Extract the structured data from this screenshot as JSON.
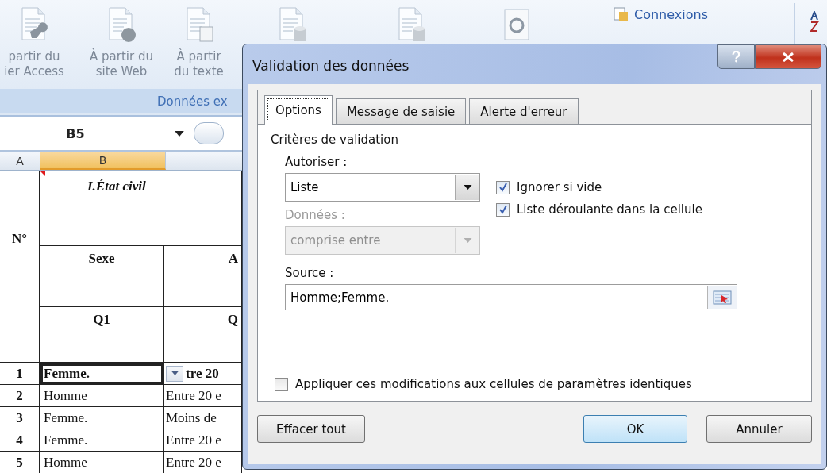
{
  "ribbon": {
    "buttons": [
      {
        "kind": "access",
        "lines": [
          "partir du",
          "ier Access"
        ]
      },
      {
        "kind": "web",
        "lines": [
          "À partir du",
          "site Web"
        ]
      },
      {
        "kind": "text",
        "lines": [
          "À partir",
          "du texte"
        ]
      },
      {
        "kind": "database"
      },
      {
        "kind": "database"
      },
      {
        "kind": "refresh"
      }
    ],
    "group_label": "Données ex",
    "connections": "Connexions"
  },
  "name_box": "B5",
  "column_headers": [
    {
      "label": "A",
      "selected": false
    },
    {
      "label": "B",
      "selected": true
    }
  ],
  "sheet": {
    "title": "I.État civil",
    "number_header": "N°",
    "headers": [
      "Sexe",
      "A"
    ],
    "codes": [
      "Q1",
      "Q"
    ],
    "rows": [
      {
        "n": "1",
        "sexe": "Femme.",
        "age": "tre 20",
        "selected": true
      },
      {
        "n": "2",
        "sexe": "Homme",
        "age": "Entre 20 e",
        "selected": false
      },
      {
        "n": "3",
        "sexe": "Femme.",
        "age": "Moins de",
        "selected": false
      },
      {
        "n": "4",
        "sexe": "Femme.",
        "age": "Entre 20 e",
        "selected": false
      },
      {
        "n": "5",
        "sexe": "Homme",
        "age": "Entre 20 e",
        "selected": false
      }
    ]
  },
  "dialog": {
    "title": "Validation des données",
    "tabs": [
      {
        "label": "Options",
        "selected": true
      },
      {
        "label": "Message de saisie",
        "selected": false
      },
      {
        "label": "Alerte d'erreur",
        "selected": false
      }
    ],
    "section": "Critères de validation",
    "allow": {
      "label": "Autoriser :",
      "value": "Liste",
      "disabled": false
    },
    "data": {
      "label": "Données :",
      "value": "comprise entre",
      "disabled": true
    },
    "checkboxes": [
      {
        "label": "Ignorer si vide",
        "checked": true
      },
      {
        "label": "Liste déroulante dans la cellule",
        "checked": true
      }
    ],
    "source": {
      "label": "Source :",
      "value": "Homme;Femme."
    },
    "apply": {
      "label": "Appliquer ces modifications aux cellules de paramètres identiques",
      "checked": false
    },
    "buttons": [
      {
        "label": "Effacer tout",
        "kind": "clear"
      },
      {
        "label": "OK",
        "kind": "default"
      },
      {
        "label": "Annuler",
        "kind": "cancel"
      }
    ]
  }
}
